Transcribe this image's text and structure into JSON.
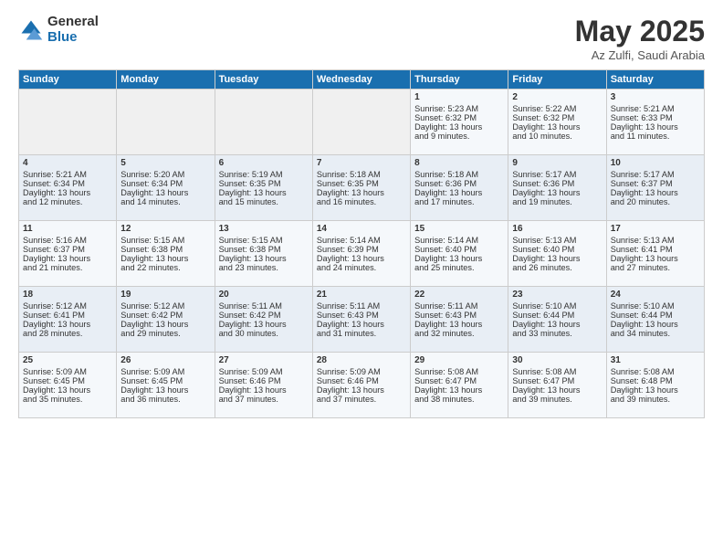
{
  "logo": {
    "general": "General",
    "blue": "Blue"
  },
  "title": "May 2025",
  "subtitle": "Az Zulfi, Saudi Arabia",
  "headers": [
    "Sunday",
    "Monday",
    "Tuesday",
    "Wednesday",
    "Thursday",
    "Friday",
    "Saturday"
  ],
  "weeks": [
    [
      {
        "day": "",
        "lines": []
      },
      {
        "day": "",
        "lines": []
      },
      {
        "day": "",
        "lines": []
      },
      {
        "day": "",
        "lines": []
      },
      {
        "day": "1",
        "lines": [
          "Sunrise: 5:23 AM",
          "Sunset: 6:32 PM",
          "Daylight: 13 hours",
          "and 9 minutes."
        ]
      },
      {
        "day": "2",
        "lines": [
          "Sunrise: 5:22 AM",
          "Sunset: 6:32 PM",
          "Daylight: 13 hours",
          "and 10 minutes."
        ]
      },
      {
        "day": "3",
        "lines": [
          "Sunrise: 5:21 AM",
          "Sunset: 6:33 PM",
          "Daylight: 13 hours",
          "and 11 minutes."
        ]
      }
    ],
    [
      {
        "day": "4",
        "lines": [
          "Sunrise: 5:21 AM",
          "Sunset: 6:34 PM",
          "Daylight: 13 hours",
          "and 12 minutes."
        ]
      },
      {
        "day": "5",
        "lines": [
          "Sunrise: 5:20 AM",
          "Sunset: 6:34 PM",
          "Daylight: 13 hours",
          "and 14 minutes."
        ]
      },
      {
        "day": "6",
        "lines": [
          "Sunrise: 5:19 AM",
          "Sunset: 6:35 PM",
          "Daylight: 13 hours",
          "and 15 minutes."
        ]
      },
      {
        "day": "7",
        "lines": [
          "Sunrise: 5:18 AM",
          "Sunset: 6:35 PM",
          "Daylight: 13 hours",
          "and 16 minutes."
        ]
      },
      {
        "day": "8",
        "lines": [
          "Sunrise: 5:18 AM",
          "Sunset: 6:36 PM",
          "Daylight: 13 hours",
          "and 17 minutes."
        ]
      },
      {
        "day": "9",
        "lines": [
          "Sunrise: 5:17 AM",
          "Sunset: 6:36 PM",
          "Daylight: 13 hours",
          "and 19 minutes."
        ]
      },
      {
        "day": "10",
        "lines": [
          "Sunrise: 5:17 AM",
          "Sunset: 6:37 PM",
          "Daylight: 13 hours",
          "and 20 minutes."
        ]
      }
    ],
    [
      {
        "day": "11",
        "lines": [
          "Sunrise: 5:16 AM",
          "Sunset: 6:37 PM",
          "Daylight: 13 hours",
          "and 21 minutes."
        ]
      },
      {
        "day": "12",
        "lines": [
          "Sunrise: 5:15 AM",
          "Sunset: 6:38 PM",
          "Daylight: 13 hours",
          "and 22 minutes."
        ]
      },
      {
        "day": "13",
        "lines": [
          "Sunrise: 5:15 AM",
          "Sunset: 6:38 PM",
          "Daylight: 13 hours",
          "and 23 minutes."
        ]
      },
      {
        "day": "14",
        "lines": [
          "Sunrise: 5:14 AM",
          "Sunset: 6:39 PM",
          "Daylight: 13 hours",
          "and 24 minutes."
        ]
      },
      {
        "day": "15",
        "lines": [
          "Sunrise: 5:14 AM",
          "Sunset: 6:40 PM",
          "Daylight: 13 hours",
          "and 25 minutes."
        ]
      },
      {
        "day": "16",
        "lines": [
          "Sunrise: 5:13 AM",
          "Sunset: 6:40 PM",
          "Daylight: 13 hours",
          "and 26 minutes."
        ]
      },
      {
        "day": "17",
        "lines": [
          "Sunrise: 5:13 AM",
          "Sunset: 6:41 PM",
          "Daylight: 13 hours",
          "and 27 minutes."
        ]
      }
    ],
    [
      {
        "day": "18",
        "lines": [
          "Sunrise: 5:12 AM",
          "Sunset: 6:41 PM",
          "Daylight: 13 hours",
          "and 28 minutes."
        ]
      },
      {
        "day": "19",
        "lines": [
          "Sunrise: 5:12 AM",
          "Sunset: 6:42 PM",
          "Daylight: 13 hours",
          "and 29 minutes."
        ]
      },
      {
        "day": "20",
        "lines": [
          "Sunrise: 5:11 AM",
          "Sunset: 6:42 PM",
          "Daylight: 13 hours",
          "and 30 minutes."
        ]
      },
      {
        "day": "21",
        "lines": [
          "Sunrise: 5:11 AM",
          "Sunset: 6:43 PM",
          "Daylight: 13 hours",
          "and 31 minutes."
        ]
      },
      {
        "day": "22",
        "lines": [
          "Sunrise: 5:11 AM",
          "Sunset: 6:43 PM",
          "Daylight: 13 hours",
          "and 32 minutes."
        ]
      },
      {
        "day": "23",
        "lines": [
          "Sunrise: 5:10 AM",
          "Sunset: 6:44 PM",
          "Daylight: 13 hours",
          "and 33 minutes."
        ]
      },
      {
        "day": "24",
        "lines": [
          "Sunrise: 5:10 AM",
          "Sunset: 6:44 PM",
          "Daylight: 13 hours",
          "and 34 minutes."
        ]
      }
    ],
    [
      {
        "day": "25",
        "lines": [
          "Sunrise: 5:09 AM",
          "Sunset: 6:45 PM",
          "Daylight: 13 hours",
          "and 35 minutes."
        ]
      },
      {
        "day": "26",
        "lines": [
          "Sunrise: 5:09 AM",
          "Sunset: 6:45 PM",
          "Daylight: 13 hours",
          "and 36 minutes."
        ]
      },
      {
        "day": "27",
        "lines": [
          "Sunrise: 5:09 AM",
          "Sunset: 6:46 PM",
          "Daylight: 13 hours",
          "and 37 minutes."
        ]
      },
      {
        "day": "28",
        "lines": [
          "Sunrise: 5:09 AM",
          "Sunset: 6:46 PM",
          "Daylight: 13 hours",
          "and 37 minutes."
        ]
      },
      {
        "day": "29",
        "lines": [
          "Sunrise: 5:08 AM",
          "Sunset: 6:47 PM",
          "Daylight: 13 hours",
          "and 38 minutes."
        ]
      },
      {
        "day": "30",
        "lines": [
          "Sunrise: 5:08 AM",
          "Sunset: 6:47 PM",
          "Daylight: 13 hours",
          "and 39 minutes."
        ]
      },
      {
        "day": "31",
        "lines": [
          "Sunrise: 5:08 AM",
          "Sunset: 6:48 PM",
          "Daylight: 13 hours",
          "and 39 minutes."
        ]
      }
    ]
  ]
}
